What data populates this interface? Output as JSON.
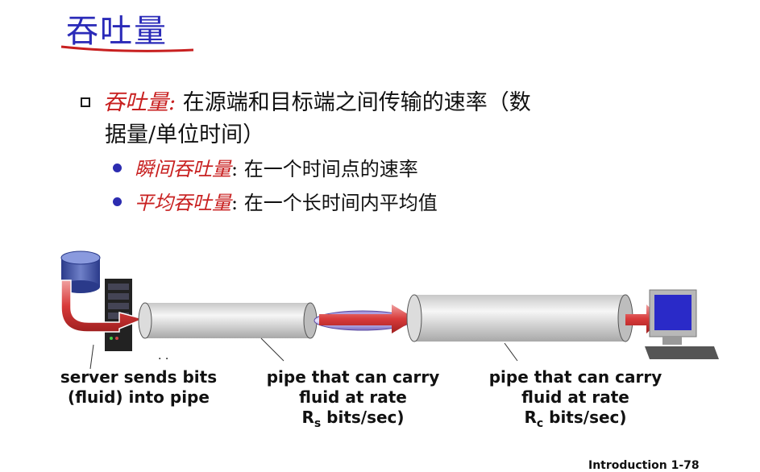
{
  "slide": {
    "title": "吞吐量",
    "main_point": {
      "term": "吞吐量:",
      "text_line1": " 在源端和目标端之间传输的速率（数",
      "text_line2": "据量/单位时间）"
    },
    "sub_points": [
      {
        "term": "瞬间吞吐量",
        "text": ": 在一个时间点的速率"
      },
      {
        "term": "平均吞吐量",
        "text": ": 在一个长时间内平均值"
      }
    ],
    "captions": {
      "server": [
        "server sends bits",
        "(fluid) into pipe"
      ],
      "pipe_s": {
        "line1": "pipe that can carry",
        "line2": "fluid at rate",
        "rate_symbol": "R",
        "rate_sub": "s",
        "rate_unit": " bits/sec)"
      },
      "pipe_c": {
        "line1": "pipe that can carry",
        "line2": "fluid at rate",
        "rate_symbol": "R",
        "rate_sub": "c",
        "rate_unit": " bits/sec)"
      }
    },
    "footer": "Introduction   1-78"
  },
  "colors": {
    "title": "#2a2ab8",
    "term": "#c82020",
    "bullet": "#2c2cb0",
    "arrow": "#d84040"
  },
  "icons": [
    "database-icon",
    "server-rack-icon",
    "computer-monitor-icon",
    "arrow-icon"
  ]
}
